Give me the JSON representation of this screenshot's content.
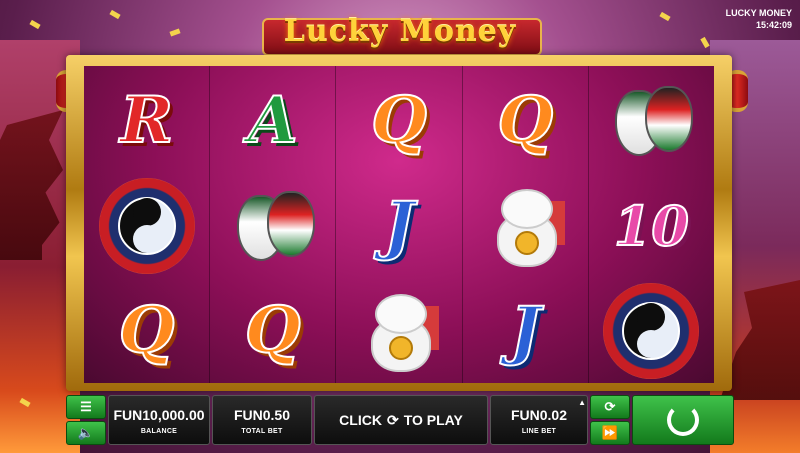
{
  "header": {
    "logo_text": "Lucky Money",
    "game_name": "LUCKY MONEY",
    "clock": "15:42:09"
  },
  "reels": [
    [
      "R",
      "yinyang",
      "Q"
    ],
    [
      "A",
      "masks",
      "Q"
    ],
    [
      "Q",
      "J",
      "cat"
    ],
    [
      "Q",
      "cat",
      "J"
    ],
    [
      "masks",
      "10",
      "yinyang"
    ]
  ],
  "bottom_bar": {
    "menu_icon": "hamburger-icon",
    "sound_icon": "speaker-icon",
    "balance_value": "FUN10,000.00",
    "balance_label": "BALANCE",
    "total_bet_value": "FUN0.50",
    "total_bet_label": "TOTAL BET",
    "click_to_play_pre": "CLICK",
    "click_to_play_post": "TO PLAY",
    "line_bet_value": "FUN0.02",
    "line_bet_label": "LINE BET",
    "autoplay_icon": "autoplay-icon",
    "fast_forward_icon": "fast-forward-icon",
    "spin_icon": "spin-icon"
  },
  "colors": {
    "accent_green": "#2ea83a",
    "frame_gold": "#e9b44a",
    "reel_bg": "#8c0f57"
  }
}
